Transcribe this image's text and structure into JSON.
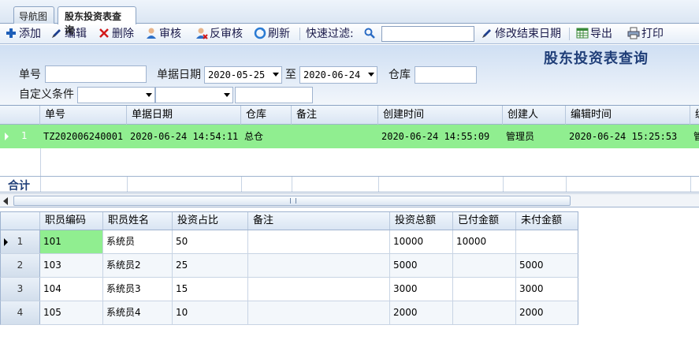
{
  "tabs": [
    {
      "label": "导航图"
    },
    {
      "label": "股东投资表查询"
    }
  ],
  "toolbar": {
    "add": "添加",
    "edit": "编辑",
    "delete": "删除",
    "audit": "审核",
    "unaudit": "反审核",
    "refresh": "刷新",
    "quick_filter": "快速过滤:",
    "quick_filter_value": "",
    "modify_end_date": "修改结束日期",
    "export": "导出",
    "print": "打印"
  },
  "filter": {
    "title": "股东投资表查询",
    "doc_no_label": "单号",
    "doc_no_value": "",
    "doc_date_label": "单据日期",
    "date_from": "2020-05-25",
    "to_label": "至",
    "date_to": "2020-06-24",
    "warehouse_label": "仓库",
    "warehouse_value": "",
    "custom_cond_label": "自定义条件",
    "custom_field": "",
    "custom_op": "",
    "custom_value": ""
  },
  "master_grid": {
    "columns": [
      "单号",
      "单据日期",
      "仓库",
      "备注",
      "创建时间",
      "创建人",
      "编辑时间",
      "编"
    ],
    "rows": [
      {
        "num": "1",
        "doc_no": "TZ202006240001",
        "doc_date": "2020-06-24 14:54:11",
        "warehouse": "总仓",
        "remark": "",
        "created_at": "2020-06-24 14:55:09",
        "creator": "管理员",
        "edited_at": "2020-06-24 15:25:53",
        "editor": "管"
      }
    ],
    "total_label": "合计",
    "selected_row_color": "#90ee90"
  },
  "detail_grid": {
    "columns": [
      "职员编码",
      "职员姓名",
      "投资占比",
      "备注",
      "投资总额",
      "已付金额",
      "未付金额"
    ],
    "rows": [
      {
        "num": "1",
        "code": "101",
        "name": "系统员",
        "ratio": "50",
        "remark": "",
        "total": "10000",
        "paid": "10000",
        "unpaid": ""
      },
      {
        "num": "2",
        "code": "103",
        "name": "系统员2",
        "ratio": "25",
        "remark": "",
        "total": "5000",
        "paid": "",
        "unpaid": "5000"
      },
      {
        "num": "3",
        "code": "104",
        "name": "系统员3",
        "ratio": "15",
        "remark": "",
        "total": "3000",
        "paid": "",
        "unpaid": "3000"
      },
      {
        "num": "4",
        "code": "105",
        "name": "系统员4",
        "ratio": "10",
        "remark": "",
        "total": "2000",
        "paid": "",
        "unpaid": "2000"
      }
    ]
  }
}
